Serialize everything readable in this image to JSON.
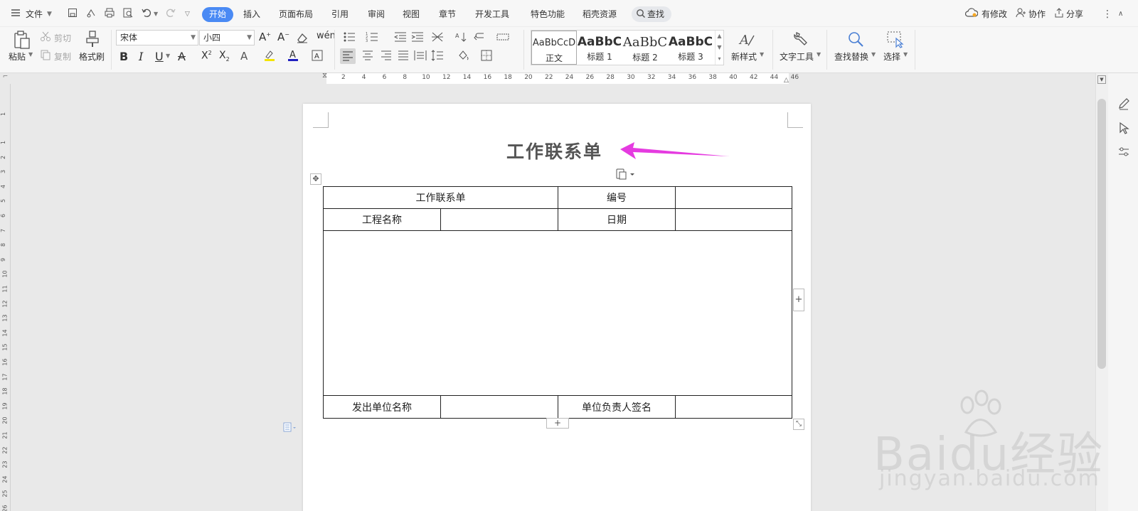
{
  "menubar": {
    "file_label": "文件",
    "tabs": [
      "开始",
      "插入",
      "页面布局",
      "引用",
      "审阅",
      "视图",
      "章节",
      "开发工具",
      "特色功能",
      "稻壳资源"
    ],
    "search_label": "查找",
    "has_changes_label": "有修改",
    "collab_label": "协作",
    "share_label": "分享",
    "accent_color": "#4a8af4"
  },
  "ribbon": {
    "paste_label": "粘贴",
    "cut_label": "剪切",
    "copy_label": "复制",
    "format_painter_label": "格式刷",
    "font_name": "宋体",
    "font_size": "小四",
    "styles": [
      {
        "sample": "AaBbCcD",
        "name": "正文"
      },
      {
        "sample": "AaBbC",
        "name": "标题 1"
      },
      {
        "sample": "AaBbC",
        "name": "标题 2"
      },
      {
        "sample": "AaBbC",
        "name": "标题 3"
      }
    ],
    "new_style_label": "新样式",
    "text_tools_label": "文字工具",
    "find_replace_label": "查找替换",
    "select_label": "选择"
  },
  "ruler": {
    "h_ticks": [
      "2",
      "4",
      "6",
      "8",
      "10",
      "12",
      "14",
      "16",
      "18",
      "20",
      "22",
      "24",
      "26",
      "28",
      "30",
      "32",
      "34",
      "36",
      "38",
      "40",
      "42",
      "44",
      "46"
    ],
    "v_ticks": [
      "1",
      "1",
      "2",
      "3",
      "4",
      "5",
      "6",
      "7",
      "8",
      "9",
      "10",
      "11",
      "12",
      "13",
      "14",
      "15",
      "16",
      "17",
      "18",
      "19",
      "20",
      "21",
      "22",
      "23",
      "24",
      "25",
      "26"
    ]
  },
  "document": {
    "title": "工作联系单",
    "table": {
      "row1": [
        "工作联系单",
        "编号",
        ""
      ],
      "row2": [
        "工程名称",
        "",
        "日期",
        ""
      ],
      "row4": [
        "发出单位名称",
        "",
        "单位负责人签名",
        ""
      ]
    },
    "arrow_color": "#e53be0"
  },
  "watermark": {
    "main": "Baidu经验",
    "sub": "jingyan.baidu.com"
  }
}
